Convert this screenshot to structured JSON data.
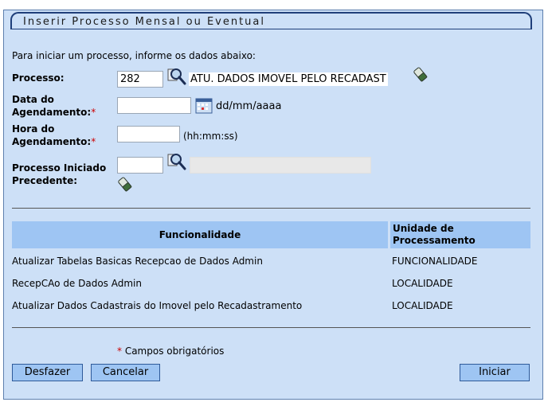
{
  "form": {
    "title": "Inserir Processo Mensal ou Eventual",
    "intro": "Para iniciar um processo, informe os dados abaixo:",
    "processo_label": "Processo:",
    "processo_value": "282",
    "processo_desc": "ATU. DADOS IMOVEL PELO RECADAST",
    "data_label_1": "Data do",
    "data_label_2": "Agendamento:",
    "data_value": "",
    "data_hint": "dd/mm/aaaa",
    "hora_label_1": "Hora do",
    "hora_label_2": "Agendamento:",
    "hora_value": "",
    "hora_hint": "(hh:mm:ss)",
    "precedente_label_1": "Processo Iniciado",
    "precedente_label_2": "Precedente:",
    "precedente_value": "",
    "required_mark": "*",
    "required_note": "Campos obrigatórios"
  },
  "table": {
    "headers": {
      "funcionalidade": "Funcionalidade",
      "unidade_1": "Unidade de",
      "unidade_2": "Processamento"
    },
    "rows": [
      {
        "funcionalidade": "Atualizar Tabelas Basicas Recepcao de Dados Admin",
        "unidade": "FUNCIONALIDADE"
      },
      {
        "funcionalidade": "RecepCAo de Dados Admin",
        "unidade": "LOCALIDADE"
      },
      {
        "funcionalidade": "Atualizar Dados Cadastrais do Imovel pelo Recadastramento",
        "unidade": "LOCALIDADE"
      }
    ]
  },
  "buttons": {
    "desfazer": "Desfazer",
    "cancelar": "Cancelar",
    "iniciar": "Iniciar"
  },
  "icons": {
    "search": "magnifier-icon",
    "eraser": "eraser-icon",
    "calendar": "calendar-icon"
  },
  "colors": {
    "panel": "#cde0f7",
    "header": "#9ec5f3",
    "required": "#cc0000"
  }
}
